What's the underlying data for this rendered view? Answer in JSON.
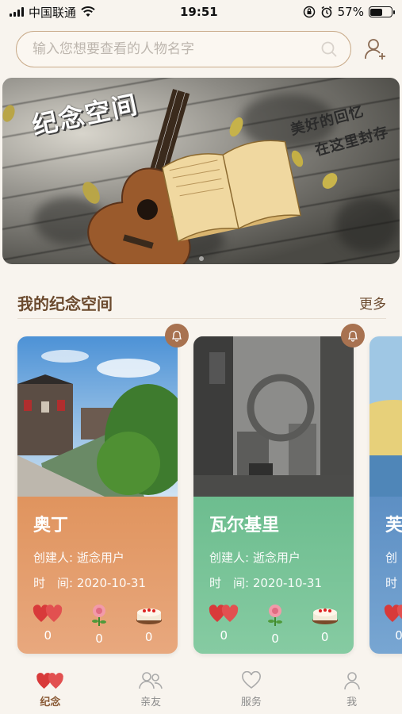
{
  "status_bar": {
    "carrier": "中国联通",
    "time": "19:51",
    "battery": "57%",
    "battery_level": 0.57
  },
  "search": {
    "placeholder": "输入您想要查看的人物名字"
  },
  "banner": {
    "title": "纪念空间",
    "subtitle_line1": "美好的回忆",
    "subtitle_line2": "在这里封存"
  },
  "section": {
    "title": "我的纪念空间",
    "more": "更多"
  },
  "cards": [
    {
      "name": "奥丁",
      "creator": "创建人: 逝念用户",
      "time": "时　间: 2020-10-31",
      "gifts": [
        {
          "icon": "heart-gift-icon",
          "count": "0"
        },
        {
          "icon": "flower-gift-icon",
          "count": "0"
        },
        {
          "icon": "cake-gift-icon",
          "count": "0"
        }
      ],
      "color": "#e0945e"
    },
    {
      "name": "瓦尔基里",
      "creator": "创建人: 逝念用户",
      "time": "时　间: 2020-10-31",
      "gifts": [
        {
          "icon": "heart-gift-icon",
          "count": "0"
        },
        {
          "icon": "flower-gift-icon",
          "count": "0"
        },
        {
          "icon": "cake-gift-icon",
          "count": "0"
        }
      ],
      "color": "#6dbd8f"
    },
    {
      "name": "芙",
      "creator": "创",
      "time": "时",
      "gifts": [
        {
          "icon": "heart-gift-icon",
          "count": "0"
        }
      ],
      "color": "#5d8fc4"
    }
  ],
  "tabbar": {
    "items": [
      {
        "label": "纪念",
        "icon": "hearts-icon",
        "active": true
      },
      {
        "label": "亲友",
        "icon": "friends-icon",
        "active": false
      },
      {
        "label": "服务",
        "icon": "heart-outline-icon",
        "active": false
      },
      {
        "label": "我",
        "icon": "person-icon",
        "active": false
      }
    ]
  },
  "colors": {
    "accent": "#8a5a35",
    "background": "#f8f4ee",
    "card1": "#e0945e",
    "card2": "#6dbd8f",
    "card3": "#5d8fc4"
  }
}
